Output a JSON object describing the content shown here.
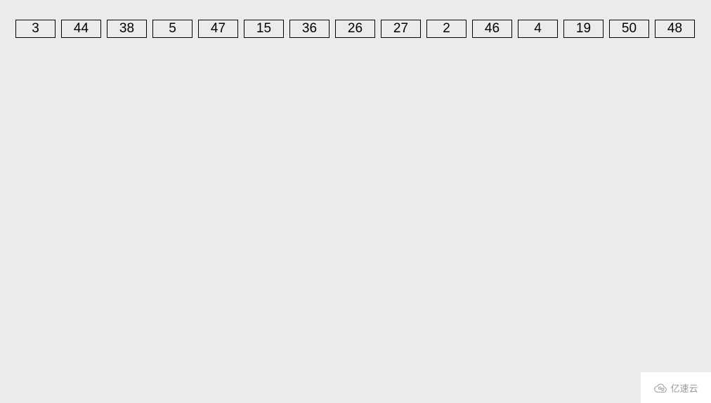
{
  "numbers": [
    3,
    44,
    38,
    5,
    47,
    15,
    36,
    26,
    27,
    2,
    46,
    4,
    19,
    50,
    48
  ],
  "watermark": {
    "text": "亿速云"
  }
}
